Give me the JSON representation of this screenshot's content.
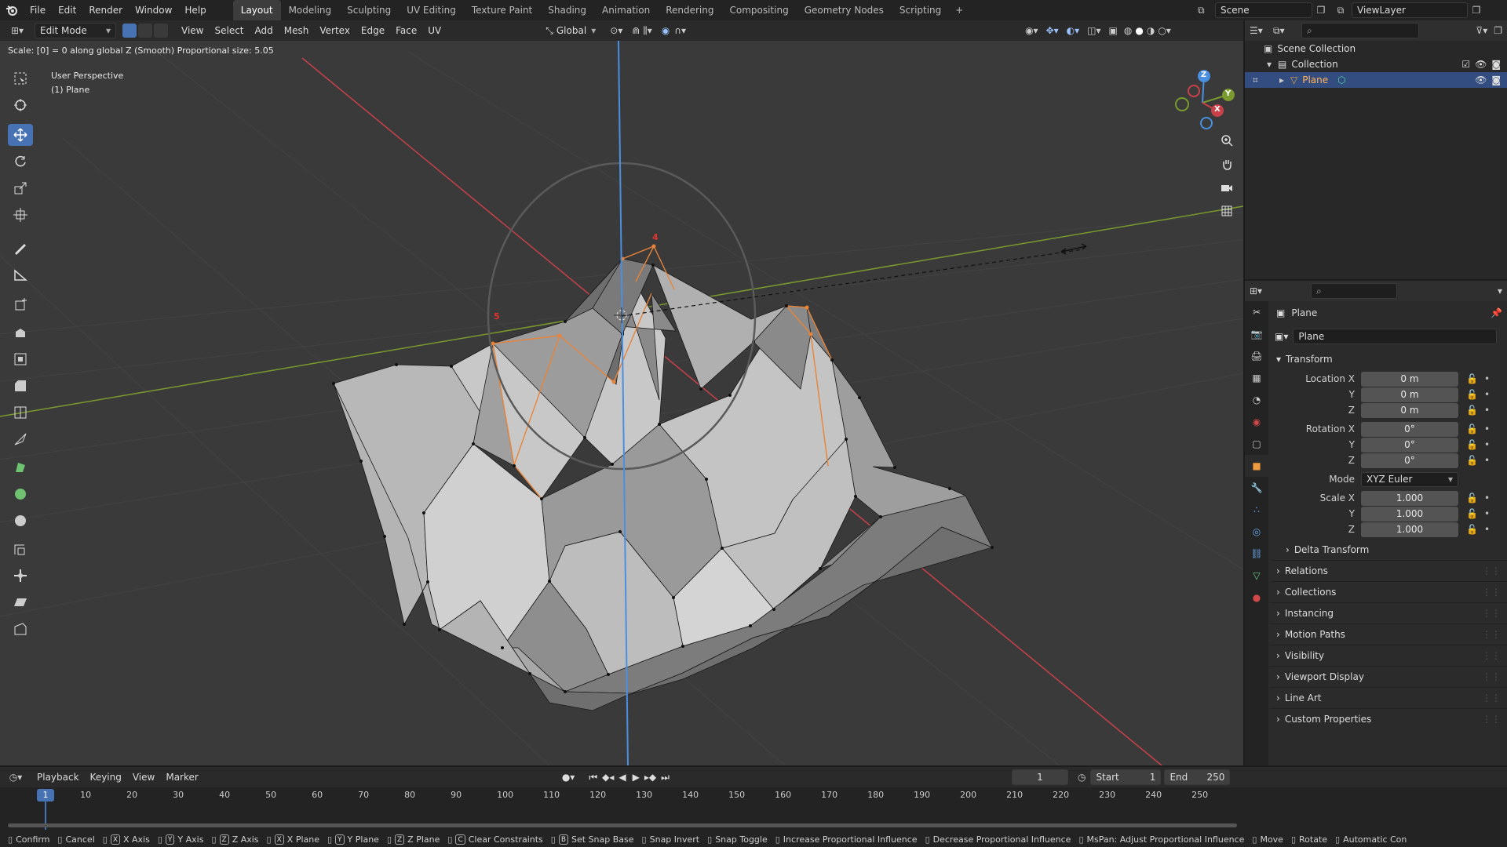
{
  "topbar": {
    "menus": [
      "File",
      "Edit",
      "Render",
      "Window",
      "Help"
    ],
    "workspaces": [
      "Layout",
      "Modeling",
      "Sculpting",
      "UV Editing",
      "Texture Paint",
      "Shading",
      "Animation",
      "Rendering",
      "Compositing",
      "Geometry Nodes",
      "Scripting"
    ],
    "active_workspace": "Layout",
    "add_tab": "+",
    "scene_name": "Scene",
    "view_layer": "ViewLayer"
  },
  "viewport": {
    "mode": "Edit Mode",
    "menus": [
      "View",
      "Select",
      "Add",
      "Mesh",
      "Vertex",
      "Edge",
      "Face",
      "UV"
    ],
    "transform_orientation": "Global",
    "status_text": "Scale: [0] = 0  along global Z (Smooth) Proportional size: 5.05",
    "perspective": "User Perspective",
    "object_label": "(1) Plane",
    "gizmo_axes": [
      "Z",
      "Y",
      "X"
    ],
    "marker_labels": [
      "4",
      "5"
    ],
    "colors": {
      "x_axis": "#c8414a",
      "y_axis": "#7a9a2e",
      "z_axis": "#4a8fe0",
      "selected": "#e8843a",
      "active_tool": "#4772b3"
    }
  },
  "outliner": {
    "scene_collection": "Scene Collection",
    "collection": "Collection",
    "object": "Plane"
  },
  "properties": {
    "object_name": "Plane",
    "data_name": "Plane",
    "transform_title": "Transform",
    "location_label": "Location X",
    "rotation_label": "Rotation X",
    "scale_label": "Scale X",
    "y": "Y",
    "z": "Z",
    "location": [
      "0 m",
      "0 m",
      "0 m"
    ],
    "rotation": [
      "0°",
      "0°",
      "0°"
    ],
    "mode_label": "Mode",
    "mode_value": "XYZ Euler",
    "scale": [
      "1.000",
      "1.000",
      "1.000"
    ],
    "sections": [
      "Delta Transform",
      "Relations",
      "Collections",
      "Instancing",
      "Motion Paths",
      "Visibility",
      "Viewport Display",
      "Line Art",
      "Custom Properties"
    ]
  },
  "timeline": {
    "menus": [
      "Playback",
      "Keying",
      "View",
      "Marker"
    ],
    "current_frame": "1",
    "start_label": "Start",
    "start": "1",
    "end_label": "End",
    "end": "250",
    "ticks": [
      "10",
      "20",
      "30",
      "40",
      "50",
      "60",
      "70",
      "80",
      "90",
      "100",
      "110",
      "120",
      "130",
      "140",
      "150",
      "160",
      "170",
      "180",
      "190",
      "200",
      "210",
      "220",
      "230",
      "240",
      "250"
    ]
  },
  "footer": {
    "items": [
      "Confirm",
      "Cancel",
      "X Axis",
      "Y Axis",
      "Z Axis",
      "X Plane",
      "Y Plane",
      "Z Plane",
      "Clear Constraints",
      "Set Snap Base",
      "Snap Invert",
      "Snap Toggle",
      "Increase Proportional Influence",
      "Decrease Proportional Influence",
      "MsPan: Adjust Proportional Influence",
      "Move",
      "Rotate",
      "Automatic Con"
    ],
    "keys": [
      "X",
      "Y",
      "Z",
      "X",
      "Y",
      "Z",
      "C",
      "B"
    ]
  }
}
